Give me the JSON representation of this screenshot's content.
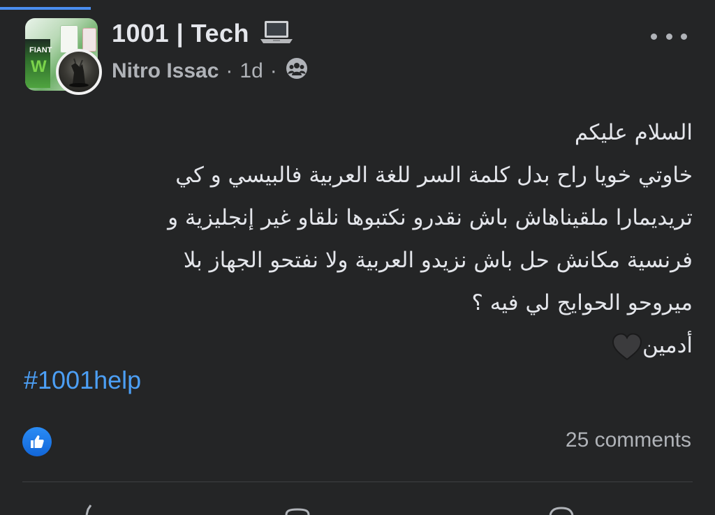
{
  "progress": {
    "fraction": 0.127,
    "color": "#4a8df0"
  },
  "post": {
    "group_name": "1001 | Tech",
    "group_icon": "laptop-icon",
    "author": "Nitro Issac",
    "separator": "·",
    "time": "1d",
    "audience_icon": "group-audience-icon",
    "more_icon": "more-options-icon",
    "body_lines": [
      "السلام عليكم",
      "خاوتي خويا راح بدل كلمة السر للغة العربية فالبيسي و كي",
      "تريديمارا ملقيناهاش باش نقدرو نكتبوها نلقاو غير إنجليزية و",
      "فرنسية مكانش حل باش نزيدو العربية ولا نفتحو الجهاز بلا",
      "ميروحو الحوايج لي فيه ؟",
      "أدمين"
    ],
    "signature_emoji": "black-heart-icon",
    "hashtag": "#1001help",
    "reaction_icon": "like-reaction-icon",
    "comments": "25 comments"
  },
  "colors": {
    "background": "#242526",
    "primary_text": "#e4e6eb",
    "secondary_text": "#b0b3b8",
    "link": "#4c9ff5",
    "like_blue": "#1877f2"
  }
}
